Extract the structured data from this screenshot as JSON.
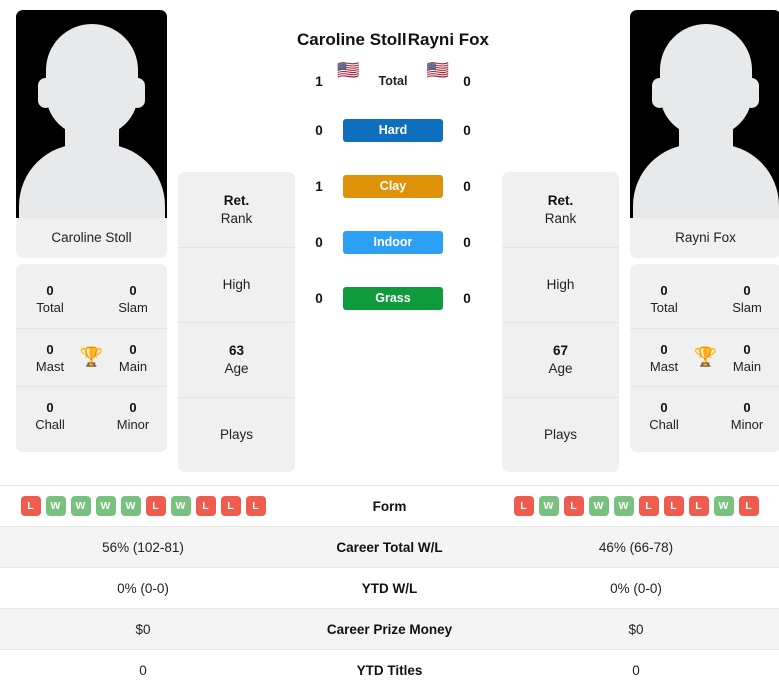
{
  "players": {
    "left": {
      "name": "Caroline Stoll",
      "photo_caption": "Caroline Stoll",
      "flag": "🇺🇸",
      "flag_name": "flag-united-states",
      "rank_value": "Ret.",
      "rank_label": "Rank",
      "high_value": "",
      "high_label": "High",
      "age_value": "63",
      "age_label": "Age",
      "plays_value": "",
      "plays_label": "Plays",
      "titles": {
        "total_value": "0",
        "total_label": "Total",
        "slam_value": "0",
        "slam_label": "Slam",
        "mast_value": "0",
        "mast_label": "Mast",
        "main_value": "0",
        "main_label": "Main",
        "chall_value": "0",
        "chall_label": "Chall",
        "minor_value": "0",
        "minor_label": "Minor"
      },
      "form": [
        "L",
        "W",
        "W",
        "W",
        "W",
        "L",
        "W",
        "L",
        "L",
        "L"
      ],
      "career_total_wl": "56% (102-81)",
      "ytd_wl": "0% (0-0)",
      "career_prize_money": "$0",
      "ytd_titles": "0"
    },
    "right": {
      "name": "Rayni Fox",
      "photo_caption": "Rayni Fox",
      "flag": "🇺🇸",
      "flag_name": "flag-united-states",
      "rank_value": "Ret.",
      "rank_label": "Rank",
      "high_value": "",
      "high_label": "High",
      "age_value": "67",
      "age_label": "Age",
      "plays_value": "",
      "plays_label": "Plays",
      "titles": {
        "total_value": "0",
        "total_label": "Total",
        "slam_value": "0",
        "slam_label": "Slam",
        "mast_value": "0",
        "mast_label": "Mast",
        "main_value": "0",
        "main_label": "Main",
        "chall_value": "0",
        "chall_label": "Chall",
        "minor_value": "0",
        "minor_label": "Minor"
      },
      "form": [
        "L",
        "W",
        "L",
        "W",
        "W",
        "L",
        "L",
        "L",
        "W",
        "L"
      ],
      "career_total_wl": "46% (66-78)",
      "ytd_wl": "0% (0-0)",
      "career_prize_money": "$0",
      "ytd_titles": "0"
    }
  },
  "head_to_head": [
    {
      "label": "Total",
      "left": "1",
      "right": "0",
      "badge": false,
      "color": ""
    },
    {
      "label": "Hard",
      "left": "0",
      "right": "0",
      "badge": true,
      "color": "#0d6fbd"
    },
    {
      "label": "Clay",
      "left": "1",
      "right": "0",
      "badge": true,
      "color": "#dd9209"
    },
    {
      "label": "Indoor",
      "left": "0",
      "right": "0",
      "badge": true,
      "color": "#2ba0f5"
    },
    {
      "label": "Grass",
      "left": "0",
      "right": "0",
      "badge": true,
      "color": "#0f9a3c"
    }
  ],
  "trophy_icon": "🏆",
  "stats_rows": [
    {
      "label": "Form",
      "type": "form"
    },
    {
      "label": "Career Total W/L",
      "type": "text",
      "key": "career_total_wl"
    },
    {
      "label": "YTD W/L",
      "type": "text",
      "key": "ytd_wl"
    },
    {
      "label": "Career Prize Money",
      "type": "text",
      "key": "career_prize_money"
    },
    {
      "label": "YTD Titles",
      "type": "text",
      "key": "ytd_titles"
    }
  ],
  "colors": {
    "win": "#78c17e",
    "loss": "#ef5b4c",
    "card_bg": "#f0f0f0",
    "stripe": "#f4f4f4"
  }
}
